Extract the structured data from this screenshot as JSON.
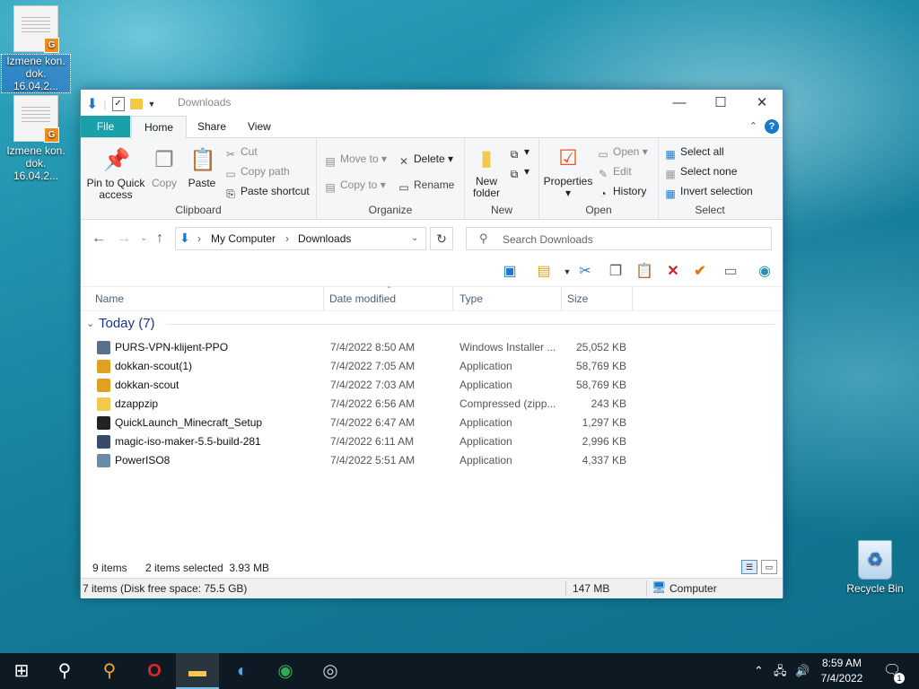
{
  "desktop": {
    "icons": [
      {
        "label_line1": "Izmene kon.",
        "label_line2": "dok. 16.04.2...",
        "badge": "G"
      },
      {
        "label_line1": "Izmene kon.",
        "label_line2": "dok. 16.04.2...",
        "badge": "G"
      }
    ],
    "recycle_bin": "Recycle Bin"
  },
  "window": {
    "title": "Downloads",
    "controls": {
      "minimize": "—",
      "maximize": "☐",
      "close": "✕"
    }
  },
  "ribbon": {
    "tabs": [
      "File",
      "Home",
      "Share",
      "View"
    ],
    "help": "?",
    "clipboard": {
      "label": "Clipboard",
      "pin": [
        "Pin to Quick",
        "access"
      ],
      "copy": "Copy",
      "paste": "Paste",
      "cut": "Cut",
      "copy_path": "Copy path",
      "paste_shortcut": "Paste shortcut"
    },
    "organize": {
      "label": "Organize",
      "move_to": "Move to",
      "copy_to": "Copy to",
      "delete": "Delete",
      "rename": "Rename"
    },
    "new": {
      "label": "New",
      "new_folder": [
        "New",
        "folder"
      ]
    },
    "open": {
      "label": "Open",
      "properties": "Properties",
      "open": "Open",
      "edit": "Edit",
      "history": "History"
    },
    "select": {
      "label": "Select",
      "select_all": "Select all",
      "select_none": "Select none",
      "invert": "Invert selection"
    }
  },
  "address": {
    "crumbs": [
      "My Computer",
      "Downloads"
    ],
    "search_placeholder": "Search Downloads"
  },
  "columns": [
    "Name",
    "Date modified",
    "Type",
    "Size"
  ],
  "group": {
    "label": "Today (7)"
  },
  "files": [
    {
      "name": "PURS-VPN-klijent-PPO",
      "date": "7/4/2022 8:50 AM",
      "type": "Windows Installer ...",
      "size": "25,052 KB",
      "icon_color": "#5a6f8a"
    },
    {
      "name": "dokkan-scout(1)",
      "date": "7/4/2022 7:05 AM",
      "type": "Application",
      "size": "58,769 KB",
      "icon_color": "#e0a020"
    },
    {
      "name": "dokkan-scout",
      "date": "7/4/2022 7:03 AM",
      "type": "Application",
      "size": "58,769 KB",
      "icon_color": "#e0a020"
    },
    {
      "name": "dzappzip",
      "date": "7/4/2022 6:56 AM",
      "type": "Compressed (zipp...",
      "size": "243 KB",
      "icon_color": "#f2c94c"
    },
    {
      "name": "QuickLaunch_Minecraft_Setup",
      "date": "7/4/2022 6:47 AM",
      "type": "Application",
      "size": "1,297 KB",
      "icon_color": "#222222"
    },
    {
      "name": "magic-iso-maker-5.5-build-281",
      "date": "7/4/2022 6:11 AM",
      "type": "Application",
      "size": "2,996 KB",
      "icon_color": "#3a4a6a"
    },
    {
      "name": "PowerISO8",
      "date": "7/4/2022 5:51 AM",
      "type": "Application",
      "size": "4,337 KB",
      "icon_color": "#6a8aa8"
    }
  ],
  "status": {
    "items": "9 items",
    "selected": "2 items selected  3.93 MB",
    "free": "7 items (Disk free space: 75.5 GB)",
    "size": "147 MB",
    "location": "Computer"
  },
  "taskbar": {
    "time": "8:59 AM",
    "date": "7/4/2022",
    "notifications": "1"
  }
}
